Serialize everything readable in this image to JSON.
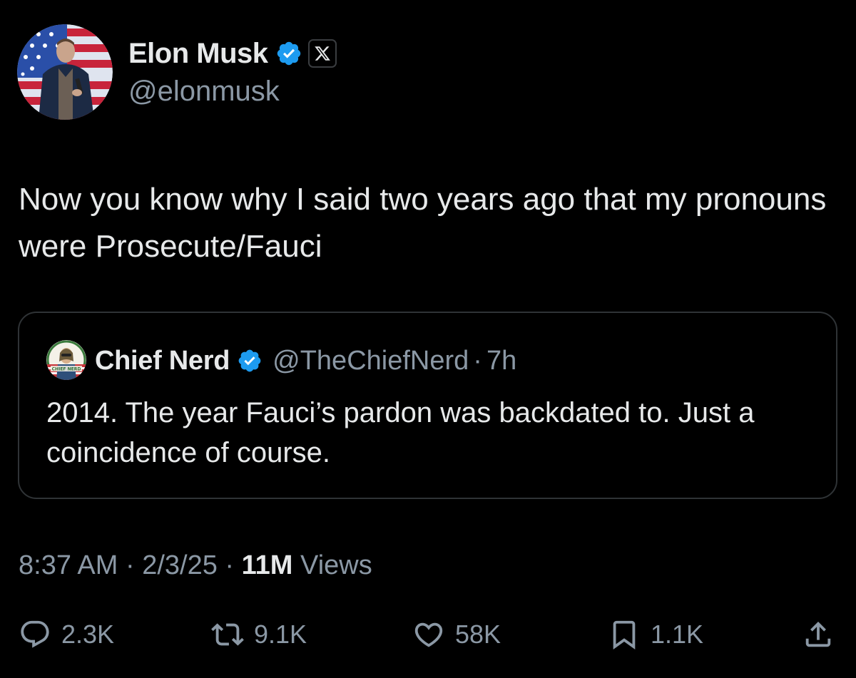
{
  "tweet": {
    "author": {
      "name": "Elon Musk",
      "handle": "@elonmusk",
      "verified": true,
      "affiliation_icon": "x-logo-icon"
    },
    "text": "Now you know why I said two years ago that my pronouns were Prosecute/Fauci",
    "quoted": {
      "name": "Chief Nerd",
      "handle": "@TheChiefNerd",
      "separator": "·",
      "time": "7h",
      "verified": true,
      "avatar_text": "CHIEF NERD",
      "text": "2014. The year Fauci’s pardon was backdated to. Just a coincidence of course."
    },
    "meta": {
      "time": "8:37 AM",
      "separator": "·",
      "date": "2/3/25",
      "views_count": "11M",
      "views_label": "Views"
    },
    "actions": {
      "replies": "2.3K",
      "reposts": "9.1K",
      "likes": "58K",
      "bookmarks": "1.1K"
    }
  },
  "colors": {
    "background": "#000000",
    "primary_text": "#e7e9ea",
    "secondary_text": "#8b98a5",
    "border": "#2f3336",
    "verified_blue": "#1d9bf0"
  }
}
